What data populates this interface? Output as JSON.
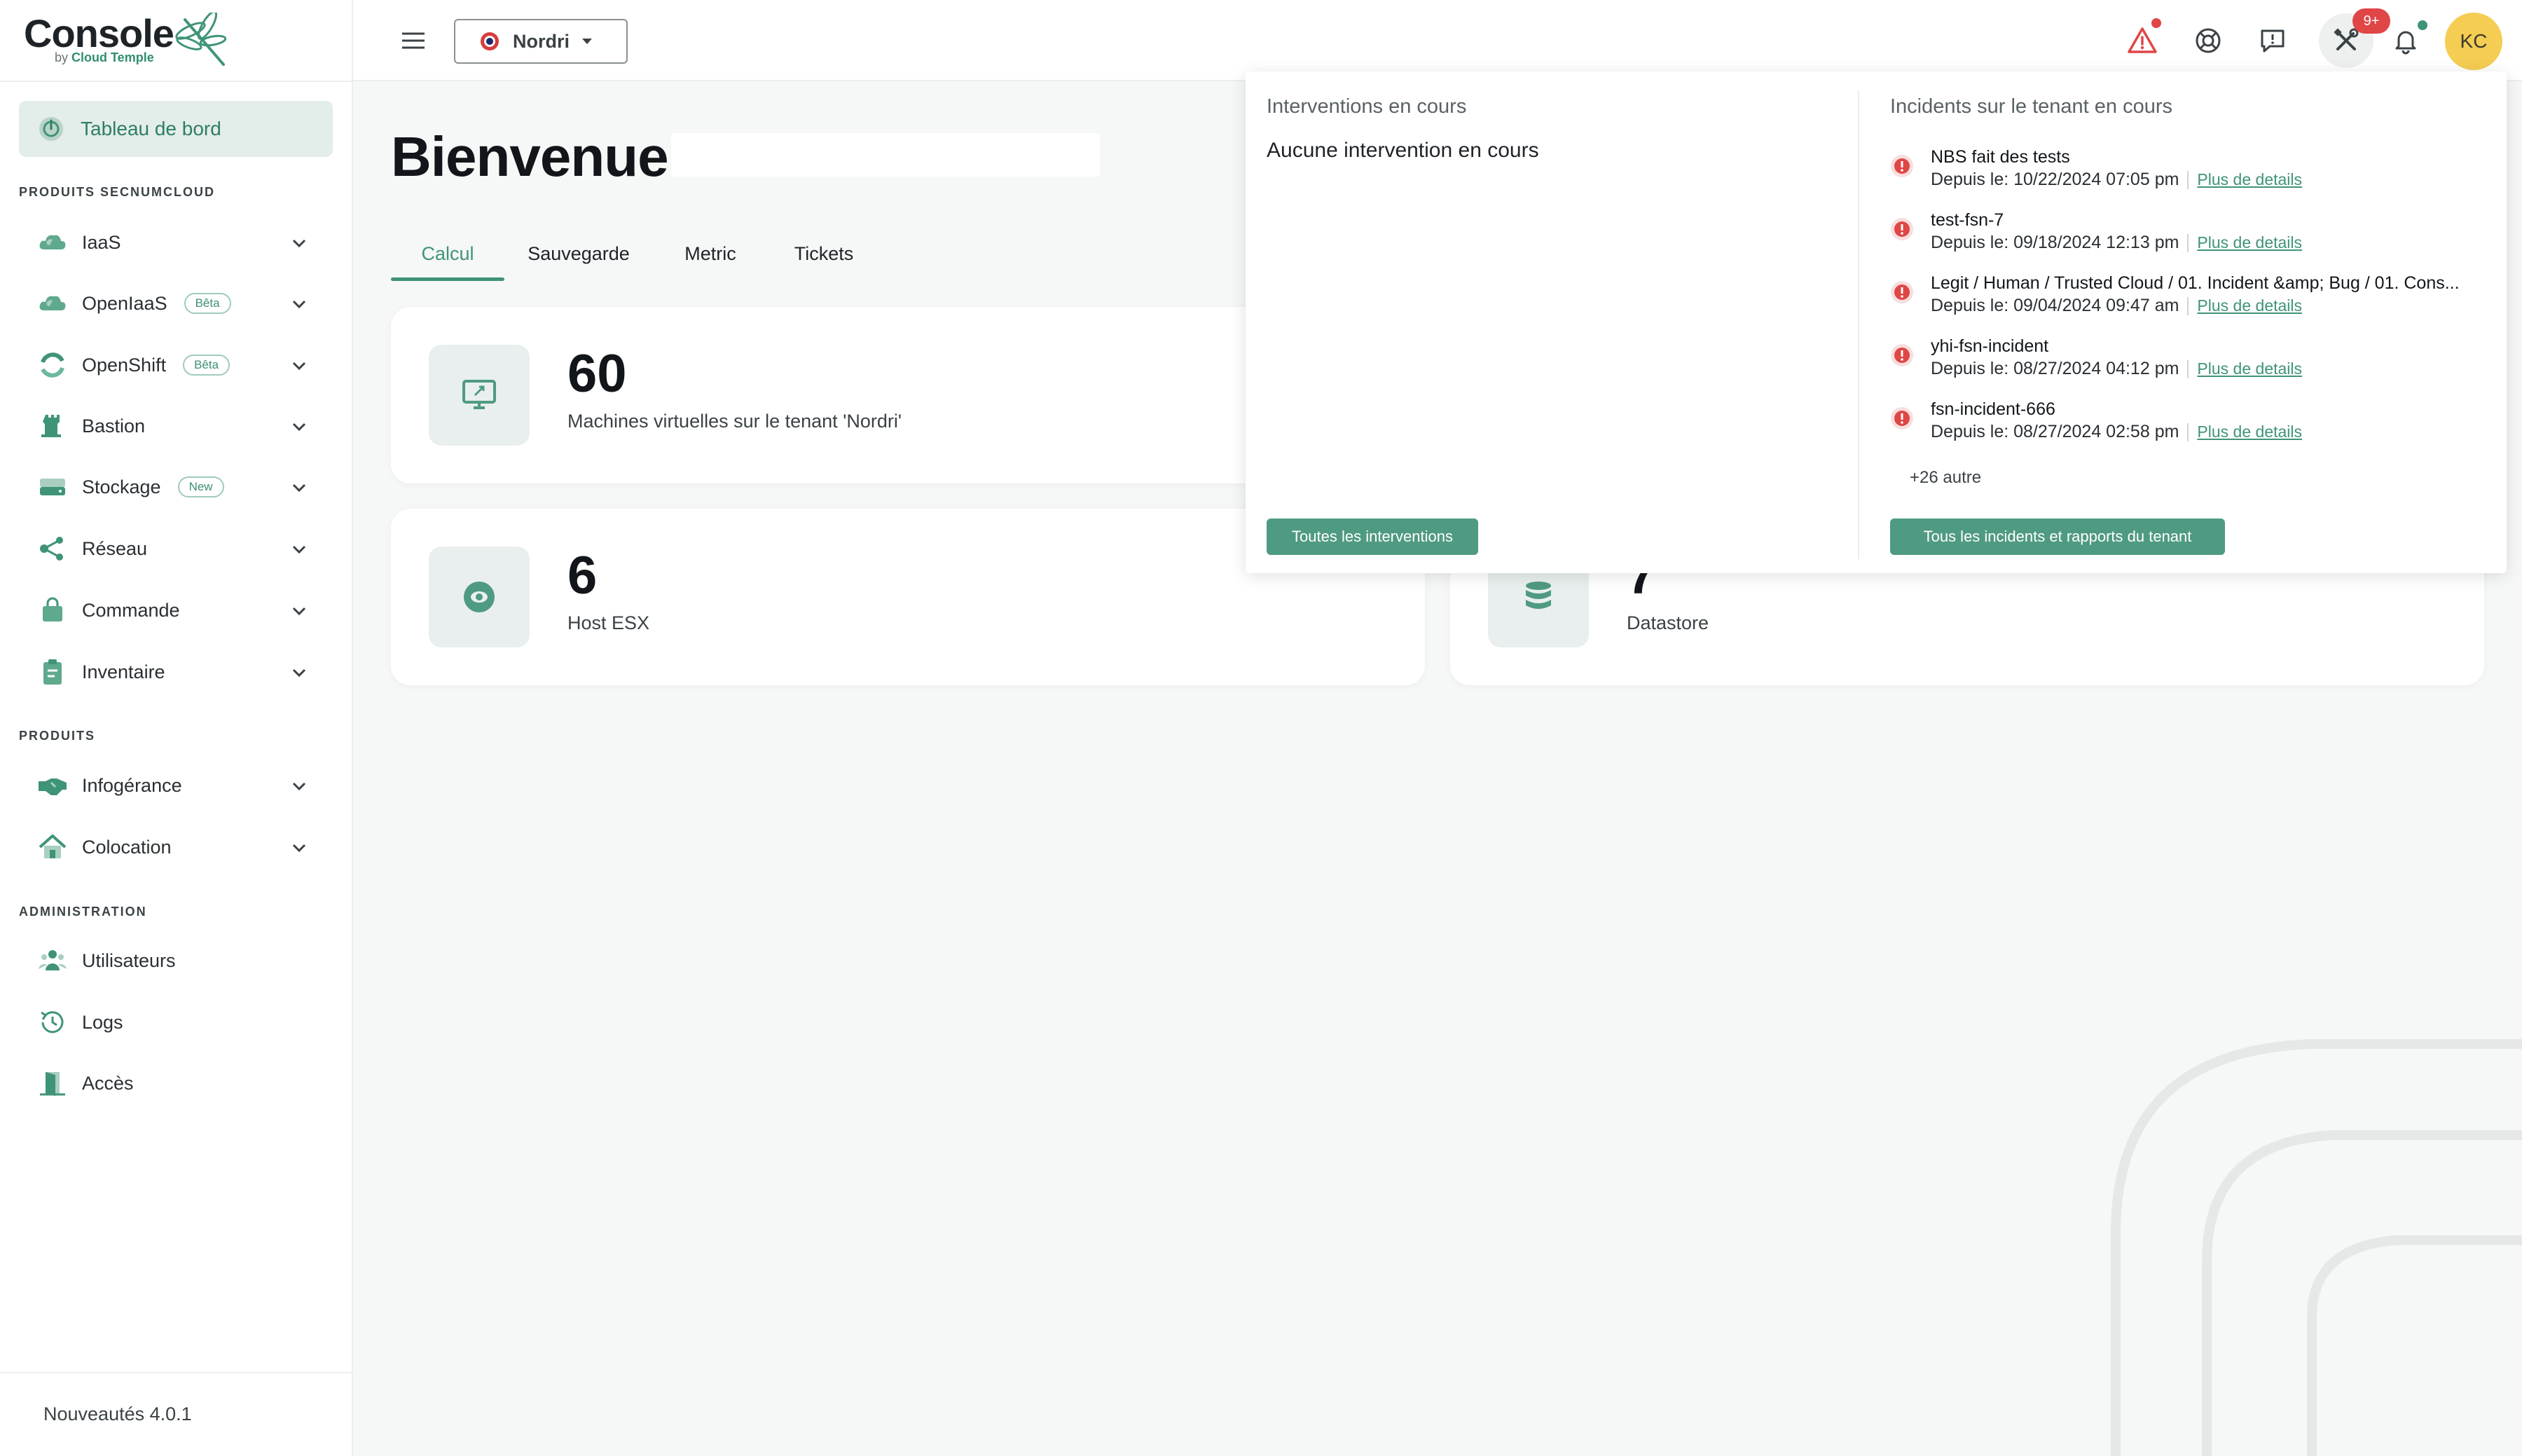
{
  "app": {
    "logo_title": "Console",
    "logo_sub_prefix": "by",
    "logo_sub_brand": "Cloud Temple"
  },
  "sidebar": {
    "dashboard_label": "Tableau de bord",
    "sections": {
      "secnumcloud": "PRODUITS SECNUMCLOUD",
      "produits": "PRODUITS",
      "administration": "ADMINISTRATION"
    },
    "items": [
      {
        "label": "IaaS",
        "icon": "cloud-icon",
        "badge": "",
        "chevron": true
      },
      {
        "label": "OpenIaaS",
        "icon": "cloud-icon",
        "badge": "Bêta",
        "chevron": true
      },
      {
        "label": "OpenShift",
        "icon": "openshift-icon",
        "badge": "Bêta",
        "chevron": true
      },
      {
        "label": "Bastion",
        "icon": "castle-icon",
        "badge": "",
        "chevron": true
      },
      {
        "label": "Stockage",
        "icon": "storage-icon",
        "badge": "New",
        "chevron": true
      },
      {
        "label": "Réseau",
        "icon": "network-icon",
        "badge": "",
        "chevron": true
      },
      {
        "label": "Commande",
        "icon": "shopping-bag-icon",
        "badge": "",
        "chevron": true
      },
      {
        "label": "Inventaire",
        "icon": "clipboard-icon",
        "badge": "",
        "chevron": true
      },
      {
        "label": "Infogérance",
        "icon": "handshake-icon",
        "badge": "",
        "chevron": true
      },
      {
        "label": "Colocation",
        "icon": "house-icon",
        "badge": "",
        "chevron": true
      },
      {
        "label": "Utilisateurs",
        "icon": "users-icon",
        "badge": "",
        "chevron": false
      },
      {
        "label": "Logs",
        "icon": "history-icon",
        "badge": "",
        "chevron": false
      },
      {
        "label": "Accès",
        "icon": "door-icon",
        "badge": "",
        "chevron": false
      }
    ],
    "news_label": "Nouveautés 4.0.1"
  },
  "topbar": {
    "tenant": "Nordri",
    "tools_badge": "9+",
    "avatar_initials": "KC"
  },
  "main": {
    "title": "Bienvenue",
    "tabs": [
      "Calcul",
      "Sauvegarde",
      "Metric",
      "Tickets"
    ],
    "active_tab": "Calcul",
    "cards": [
      {
        "value": "60",
        "label": "Machines virtuelles sur le tenant 'Nordri'",
        "icon": "monitor-icon"
      },
      {
        "value": "6",
        "label": "Host ESX",
        "icon": "eye-icon"
      },
      {
        "value": "7",
        "label": "Datastore",
        "icon": "database-icon"
      }
    ]
  },
  "panel": {
    "interventions_title": "Interventions en cours",
    "interventions_empty": "Aucune intervention en cours",
    "incidents_title": "Incidents sur le tenant en cours",
    "incidents": [
      {
        "name": "NBS fait des tests",
        "since": "Depuis le: 10/22/2024 07:05 pm",
        "link": "Plus de details"
      },
      {
        "name": "test-fsn-7",
        "since": "Depuis le: 09/18/2024 12:13 pm",
        "link": "Plus de details"
      },
      {
        "name": "Legit / Human / Trusted Cloud / 01. Incident &amp; Bug / 01. Cons...",
        "since": "Depuis le: 09/04/2024 09:47 am",
        "link": "Plus de details"
      },
      {
        "name": "yhi-fsn-incident",
        "since": "Depuis le: 08/27/2024 04:12 pm",
        "link": "Plus de details"
      },
      {
        "name": "fsn-incident-666",
        "since": "Depuis le: 08/27/2024 02:58 pm",
        "link": "Plus de details"
      }
    ],
    "more_label": "+26 autre",
    "btn_interventions": "Toutes les interventions",
    "btn_incidents": "Tous les incidents et rapports du tenant"
  },
  "colors": {
    "accent": "#3f9477",
    "accent_button": "#4f9a82",
    "alert_red": "#e04646",
    "avatar": "#f5cd53"
  }
}
